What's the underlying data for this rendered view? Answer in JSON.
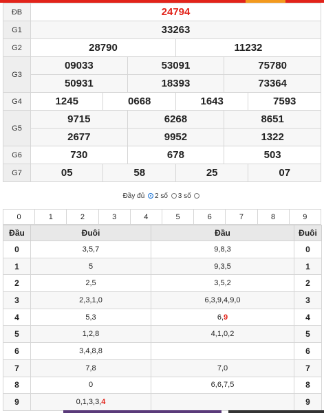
{
  "results": {
    "db": {
      "label": "ĐB",
      "numbers": [
        "24794"
      ]
    },
    "g1": {
      "label": "G1",
      "numbers": [
        "33263"
      ]
    },
    "g2": {
      "label": "G2",
      "numbers": [
        "28790",
        "11232"
      ]
    },
    "g3": {
      "label": "G3",
      "numbers": [
        "09033",
        "53091",
        "75780",
        "50931",
        "18393",
        "73364"
      ]
    },
    "g4": {
      "label": "G4",
      "numbers": [
        "1245",
        "0668",
        "1643",
        "7593"
      ]
    },
    "g5": {
      "label": "G5",
      "numbers": [
        "9715",
        "6268",
        "8651",
        "2677",
        "9952",
        "1322"
      ]
    },
    "g6": {
      "label": "G6",
      "numbers": [
        "730",
        "678",
        "503"
      ]
    },
    "g7": {
      "label": "G7",
      "numbers": [
        "05",
        "58",
        "25",
        "07"
      ]
    }
  },
  "display_options": {
    "full": "Đầy đủ",
    "two": "2 số",
    "three": "3 số",
    "selected": "2 số"
  },
  "digit_filter": [
    "0",
    "1",
    "2",
    "3",
    "4",
    "5",
    "6",
    "7",
    "8",
    "9"
  ],
  "loto": {
    "headers": {
      "dau": "Đầu",
      "duoi": "Đuôi",
      "dau2": "Đầu",
      "duoi2": "Đuôi"
    },
    "rows": [
      {
        "digit": "0",
        "tails": "3,5,7",
        "heads": "9,8,3",
        "tails_hl": "",
        "heads_hl": ""
      },
      {
        "digit": "1",
        "tails": "5",
        "heads": "9,3,5",
        "tails_hl": "",
        "heads_hl": ""
      },
      {
        "digit": "2",
        "tails": "2,5",
        "heads": "3,5,2",
        "tails_hl": "",
        "heads_hl": ""
      },
      {
        "digit": "3",
        "tails": "2,3,1,0",
        "heads": "6,3,9,4,9,0",
        "tails_hl": "",
        "heads_hl": ""
      },
      {
        "digit": "4",
        "tails": "5,3",
        "heads": "6,",
        "tails_hl": "",
        "heads_hl": "9"
      },
      {
        "digit": "5",
        "tails": "1,2,8",
        "heads": "4,1,0,2",
        "tails_hl": "",
        "heads_hl": ""
      },
      {
        "digit": "6",
        "tails": "3,4,8,8",
        "heads": "",
        "tails_hl": "",
        "heads_hl": ""
      },
      {
        "digit": "7",
        "tails": "7,8",
        "heads": "7,0",
        "tails_hl": "",
        "heads_hl": ""
      },
      {
        "digit": "8",
        "tails": "0",
        "heads": "6,6,7,5",
        "tails_hl": "",
        "heads_hl": ""
      },
      {
        "digit": "9",
        "tails": "0,1,3,3,",
        "heads": "",
        "tails_hl": "4",
        "heads_hl": ""
      }
    ]
  },
  "colors": {
    "accent": "#e2231a",
    "orange": "#f39a1e",
    "radio": "#1e76d8"
  }
}
